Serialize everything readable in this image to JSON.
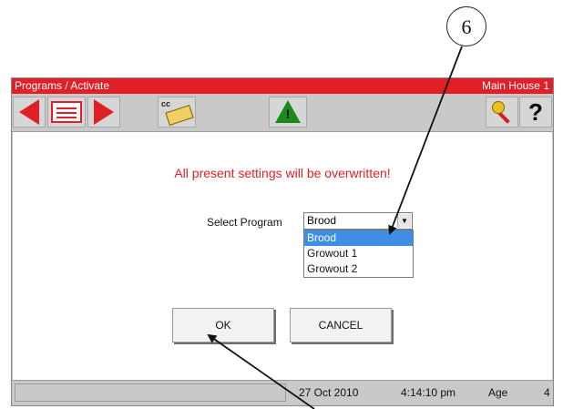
{
  "callout": {
    "number": "6"
  },
  "titlebar": {
    "left": "Programs / Activate",
    "right": "Main House 1"
  },
  "toolbar": {
    "icons": [
      "arrow-left-icon",
      "list-icon",
      "arrow-right-icon",
      "cc-card-icon",
      "warning-icon",
      "key-icon",
      "help-icon"
    ],
    "cc_text": "cc",
    "warning_glyph": "!",
    "help_glyph": "?"
  },
  "content": {
    "warning": "All present settings will be overwritten!",
    "select_label": "Select Program",
    "select_value": "Brood",
    "options": [
      "Brood",
      "Growout 1",
      "Growout 2"
    ],
    "selected_option": "Brood",
    "ok_label": "OK",
    "cancel_label": "CANCEL"
  },
  "status": {
    "date": "27 Oct 2010",
    "time": "4:14:10 pm",
    "age_label": "Age",
    "age_value": "4"
  },
  "colors": {
    "accent_red": "#e02026",
    "selection_blue": "#3f8ee6",
    "warning_green": "#1a8a1a"
  }
}
